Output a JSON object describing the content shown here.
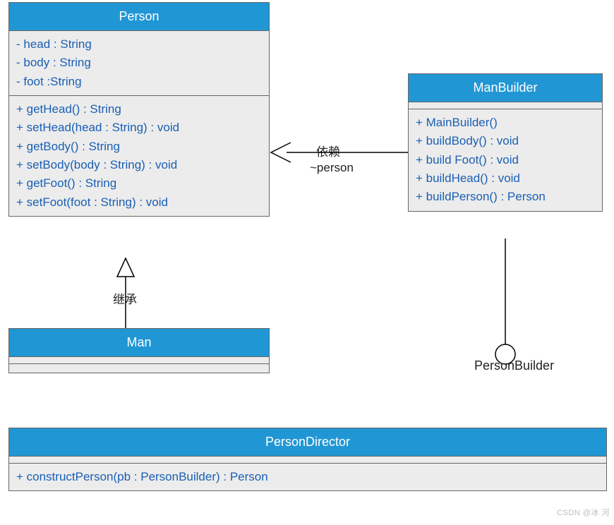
{
  "classes": {
    "person": {
      "name": "Person",
      "attributes": [
        "- head : String",
        "- body : String",
        "- foot :String"
      ],
      "methods": [
        "+ getHead() : String",
        "+ setHead(head : String) : void",
        "+ getBody() : String",
        "+ setBody(body : String) : void",
        "+ getFoot() : String",
        "+ setFoot(foot : String) : void"
      ]
    },
    "manBuilder": {
      "name": "ManBuilder",
      "methods": [
        "+ MainBuilder()",
        "+ buildBody() : void",
        "+ build Foot() : void",
        "+ buildHead() : void",
        "+ buildPerson() : Person"
      ]
    },
    "man": {
      "name": "Man"
    },
    "personDirector": {
      "name": "PersonDirector",
      "methods": [
        "+ constructPerson(pb : PersonBuilder) : Person"
      ]
    }
  },
  "relations": {
    "inheritance": "继承",
    "dependency": "依赖",
    "dependencyRole": "~person",
    "interfaceName": "PersonBuilder"
  },
  "watermark": "CSDN @冰 河"
}
